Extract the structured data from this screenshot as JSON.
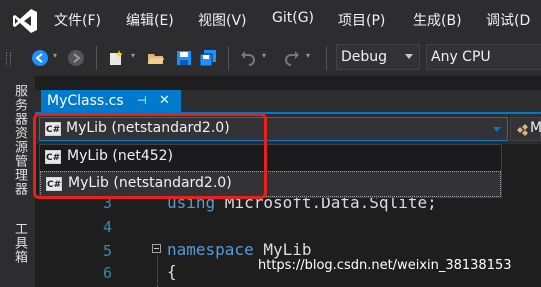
{
  "menubar": {
    "items": [
      "文件(F)",
      "编辑(E)",
      "视图(V)",
      "Git(G)",
      "项目(P)",
      "生成(B)",
      "调试(D"
    ]
  },
  "toolbar": {
    "configuration": "Debug",
    "platform": "Any CPU"
  },
  "side_panel": {
    "server_explorer": "服务器资源管理器",
    "toolbox": "工具箱"
  },
  "tab": {
    "filename": "MyClass.cs",
    "pin_glyph": "⊣",
    "close_glyph": "✕"
  },
  "project_selector": {
    "selected": "MyLib (netstandard2.0)",
    "icon_text": "C#",
    "right_label": "M",
    "options": [
      "MyLib (net452)",
      "MyLib (netstandard2.0)"
    ]
  },
  "code": {
    "lines": [
      {
        "num": "3",
        "text": "using Microsoft.Data.Sqlite;"
      },
      {
        "num": "4",
        "text": ""
      },
      {
        "num": "5",
        "keyword": "namespace",
        "text": " MyLib"
      },
      {
        "num": "6",
        "text": "{"
      }
    ]
  },
  "watermark": "https://blog.csdn.net/weixin_38138153",
  "colors": {
    "accent": "#007acc",
    "highlight_border": "#e8211b",
    "keyword": "#569cd6",
    "line_number": "#2b91af"
  }
}
